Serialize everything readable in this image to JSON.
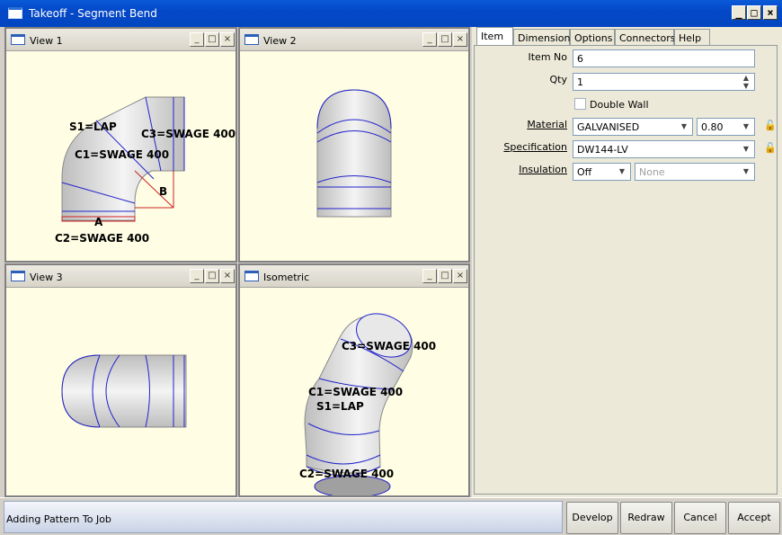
{
  "window": {
    "title": "Takeoff - Segment Bend"
  },
  "views": [
    {
      "title": "View 1"
    },
    {
      "title": "View 2"
    },
    {
      "title": "View 3"
    },
    {
      "title": "Isometric"
    }
  ],
  "view1_labels": {
    "s1": "S1=LAP",
    "c3": "C3=SWAGE 400",
    "c1": "C1=SWAGE 400",
    "b": "B",
    "a": "A",
    "c2": "C2=SWAGE 400"
  },
  "iso_labels": {
    "c3": "C3=SWAGE 400",
    "c1": "C1=SWAGE 400",
    "s1": "S1=LAP",
    "c2": "C2=SWAGE 400"
  },
  "tabs": [
    {
      "label": "Item",
      "active": true
    },
    {
      "label": "Dimensions"
    },
    {
      "label": "Options"
    },
    {
      "label": "Connectors"
    },
    {
      "label": "Help"
    }
  ],
  "item": {
    "item_no_label": "Item No",
    "item_no": "6",
    "qty_label": "Qty",
    "qty": "1",
    "double_wall_label": "Double Wall",
    "material_label": "Material",
    "material": "GALVANISED",
    "gauge": "0.80",
    "specification_label": "Specification",
    "specification": "DW144-LV",
    "insulation_label": "Insulation",
    "insulation": "Off",
    "insulation_type": "None"
  },
  "status": {
    "text": "Adding Pattern To Job"
  },
  "buttons": {
    "develop": "Develop",
    "redraw": "Redraw",
    "cancel": "Cancel",
    "accept": "Accept"
  }
}
